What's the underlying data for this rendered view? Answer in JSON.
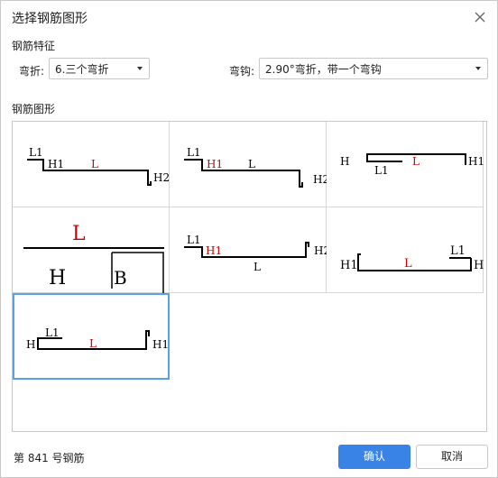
{
  "dialog": {
    "title": "选择钢筋图形"
  },
  "features": {
    "section_label": "钢筋特征",
    "bend_label": "弯折:",
    "bend_value": "6.三个弯折",
    "hook_label": "弯钩:",
    "hook_value": "2.90°弯折，带一个弯钩"
  },
  "shapes": {
    "section_label": "钢筋图形",
    "items": [
      {
        "labels": [
          "L1",
          "H1",
          "L",
          "H2"
        ]
      },
      {
        "labels": [
          "L1",
          "H1",
          "L",
          "H2"
        ]
      },
      {
        "labels": [
          "H",
          "L1",
          "L",
          "H1"
        ]
      },
      {
        "labels": [
          "L",
          "H",
          "B"
        ]
      },
      {
        "labels": [
          "L1",
          "H1",
          "L",
          "H2"
        ]
      },
      {
        "labels": [
          "H1",
          "L",
          "L1",
          "H"
        ]
      },
      {
        "labels": [
          "H",
          "L1",
          "L",
          "H1"
        ]
      }
    ]
  },
  "footer": {
    "status": "第 841 号钢筋",
    "ok_label": "确认",
    "cancel_label": "取消"
  },
  "colors": {
    "accent": "#3a83e6",
    "selected_border": "#5aa0e6",
    "label_red": "#cc0000"
  }
}
